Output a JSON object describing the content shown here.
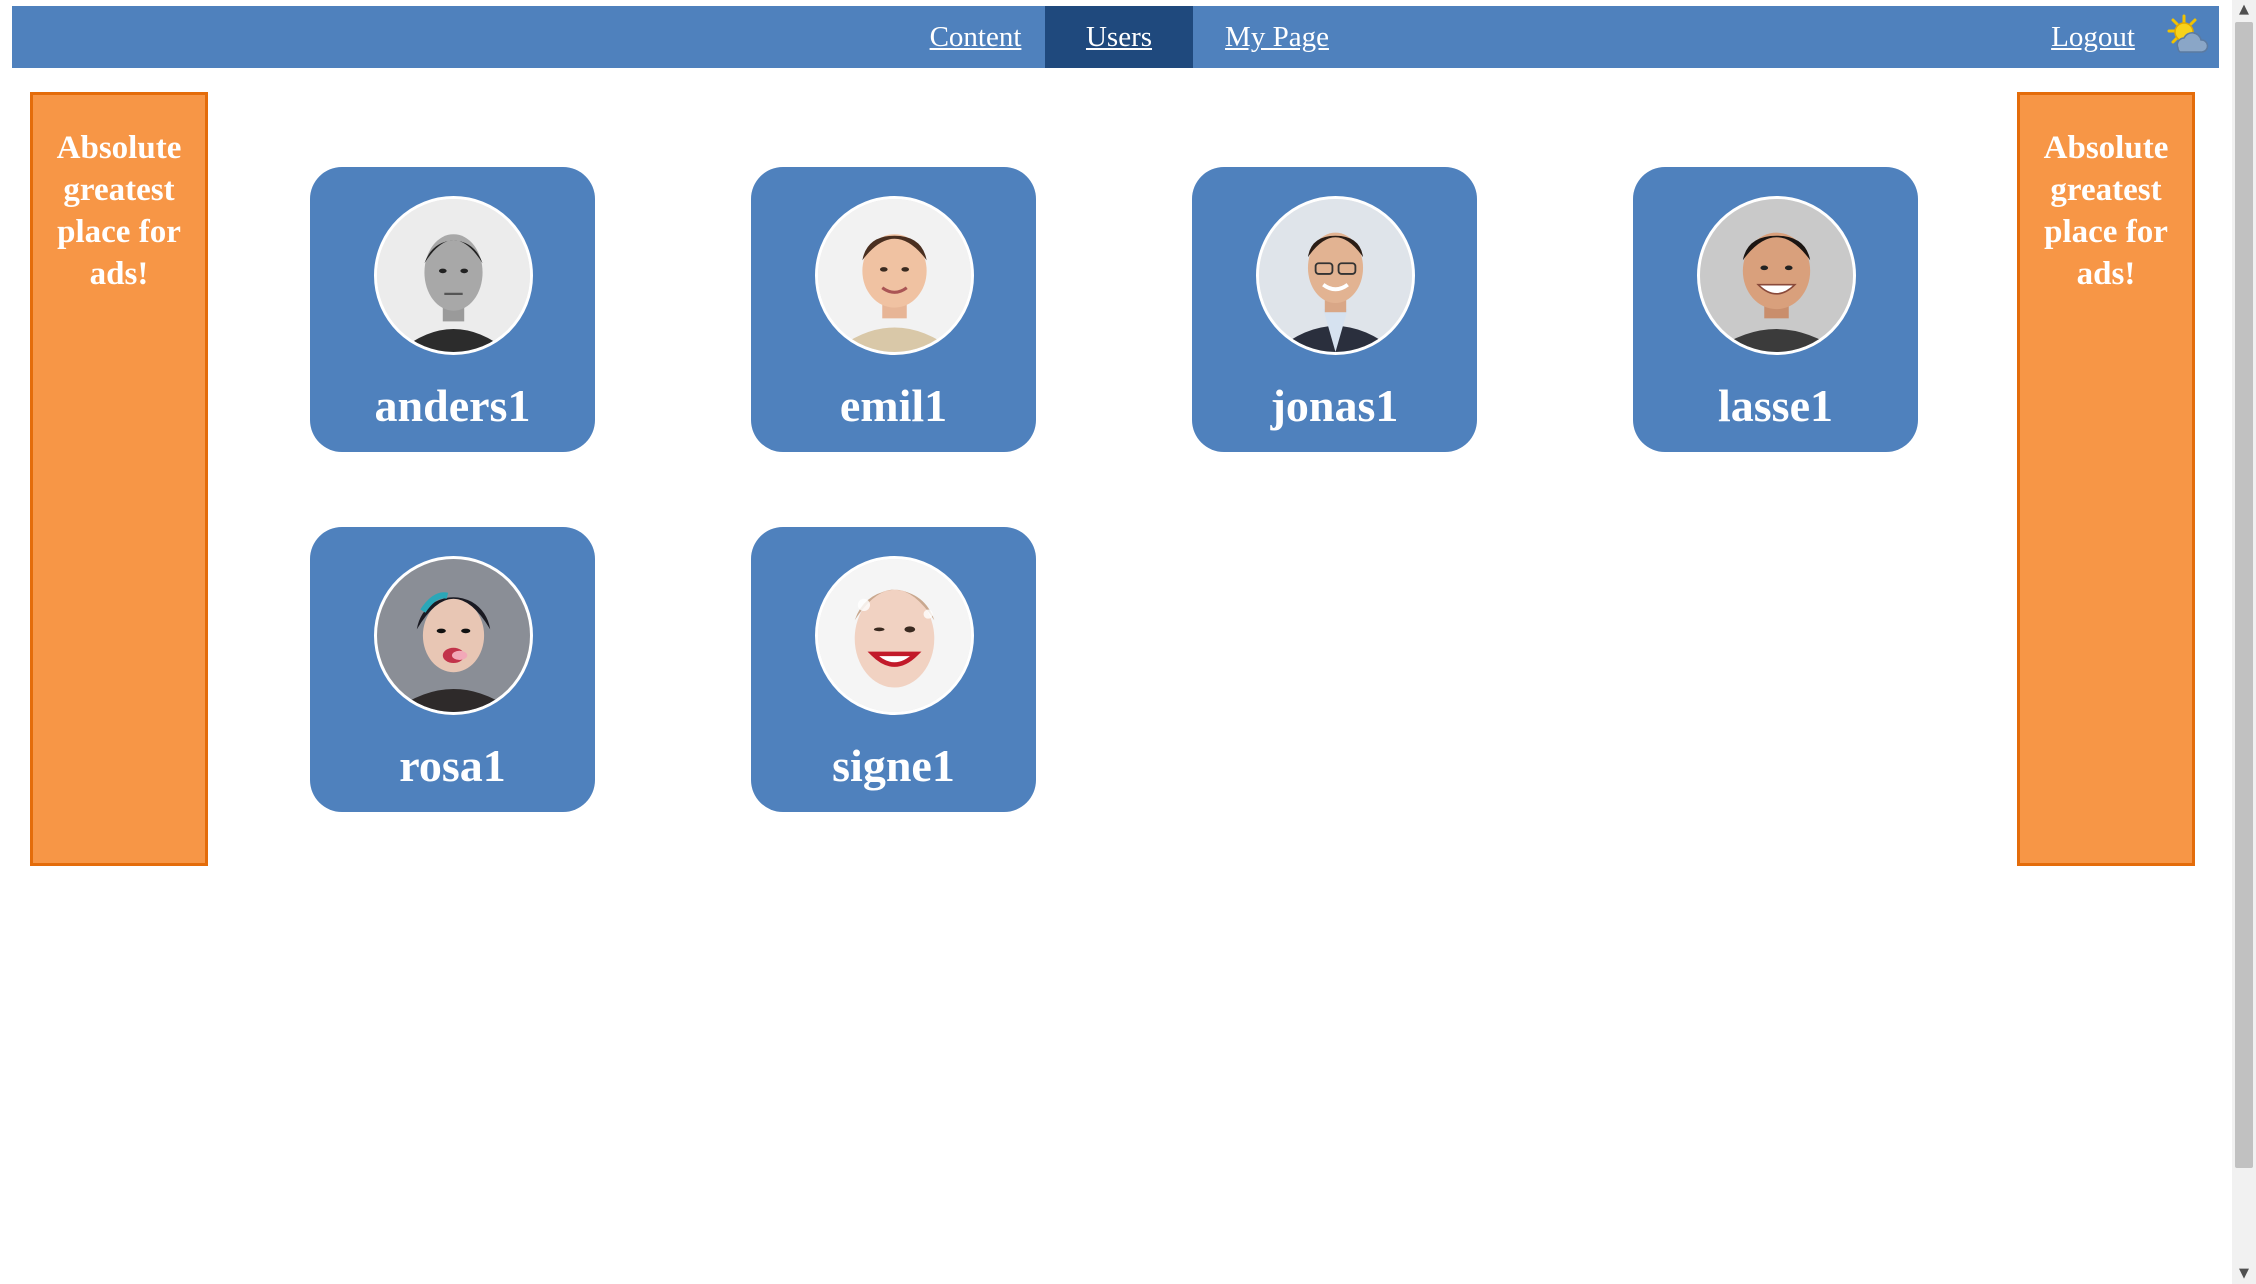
{
  "nav": {
    "items": [
      {
        "label": "Content",
        "active": false
      },
      {
        "label": "Users",
        "active": true
      },
      {
        "label": "My Page",
        "active": false
      }
    ],
    "logout_label": "Logout",
    "weather_icon": "sun-cloud-icon"
  },
  "ads": {
    "left_text": "Absolute greatest place for ads!",
    "right_text": "Absolute greatest place for ads!"
  },
  "users": [
    {
      "name": "anders1",
      "avatar": "avatar-photo"
    },
    {
      "name": "emil1",
      "avatar": "avatar-photo"
    },
    {
      "name": "jonas1",
      "avatar": "avatar-photo"
    },
    {
      "name": "lasse1",
      "avatar": "avatar-photo"
    },
    {
      "name": "rosa1",
      "avatar": "avatar-photo"
    },
    {
      "name": "signe1",
      "avatar": "avatar-photo"
    }
  ],
  "colors": {
    "nav_bg": "#4f81bd",
    "nav_active": "#1f497d",
    "card_bg": "#4f81bd",
    "ad_bg": "#f79646",
    "ad_border": "#e46c0a"
  }
}
